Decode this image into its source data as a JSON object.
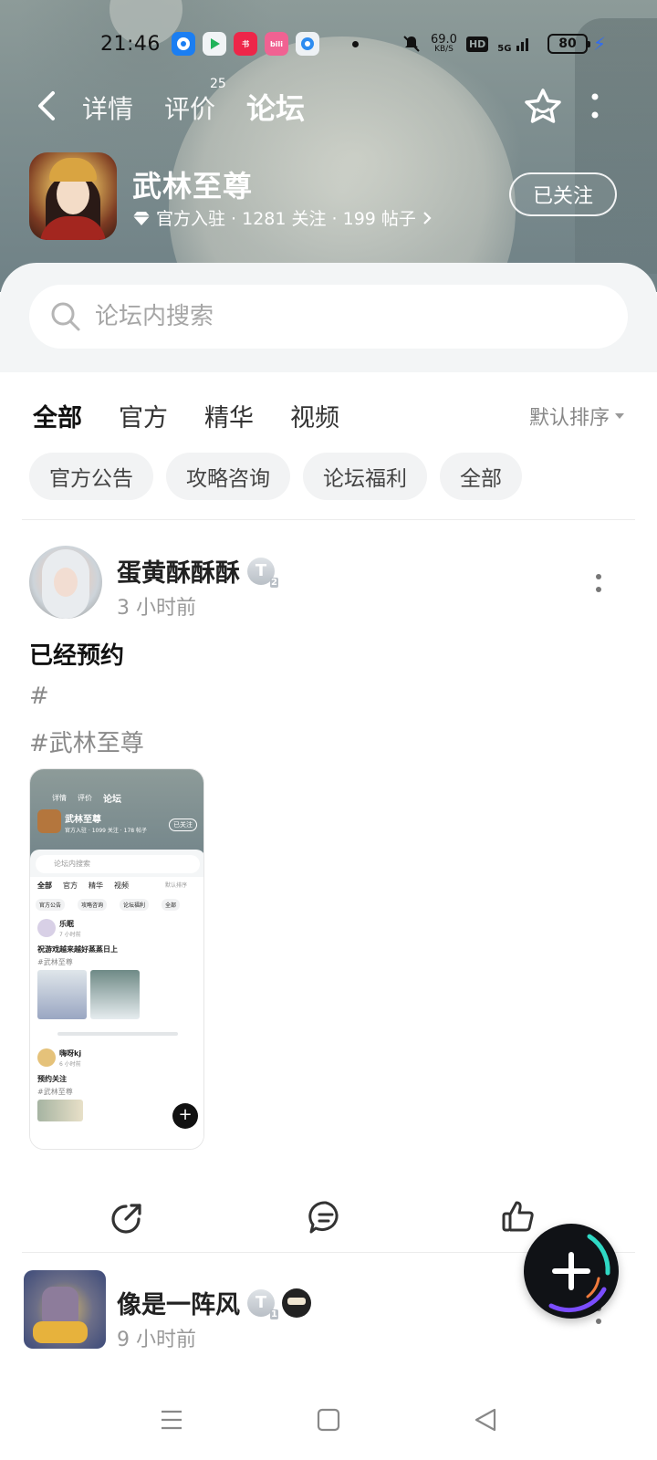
{
  "status_bar": {
    "time": "21:46",
    "net_speed_value": "69.0",
    "net_speed_unit": "KB/S",
    "hd_label": "HD",
    "signal_label": "5G",
    "battery": "80",
    "app_icons": [
      "weibo-icon",
      "video-icon",
      "xiaohongshu-icon",
      "bilibili-icon",
      "browser-icon"
    ]
  },
  "nav": {
    "tabs": [
      {
        "label": "详情"
      },
      {
        "label": "评价",
        "badge": "25"
      },
      {
        "label": "论坛"
      }
    ],
    "active_tab": "论坛"
  },
  "game": {
    "title": "武林至尊",
    "meta": "官方入驻 · 1281 关注 · 199 帖子",
    "follow_label": "已关注"
  },
  "search": {
    "placeholder": "论坛内搜索"
  },
  "filters": {
    "tabs": [
      "全部",
      "官方",
      "精华",
      "视频"
    ],
    "active": "全部",
    "sort_label": "默认排序"
  },
  "chips": [
    "官方公告",
    "攻略咨询",
    "论坛福利",
    "全部"
  ],
  "posts": [
    {
      "username": "蛋黄酥酥酥",
      "level_badge": "T",
      "level_number": "2",
      "time": "3 小时前",
      "text": "已经预约",
      "tags": [
        "#",
        "#武林至尊"
      ]
    },
    {
      "username": "像是一阵风",
      "level_badge": "T",
      "level_number": "1",
      "time": "9 小时前"
    }
  ],
  "thumbnail": {
    "tabs": [
      "详情",
      "评价",
      "论坛"
    ],
    "title": "武林至尊",
    "meta": "官方入驻 · 1099 关注 · 178 帖子",
    "follow": "已关注",
    "search": "论坛内搜索",
    "filters": [
      "全部",
      "官方",
      "精华",
      "视频"
    ],
    "sort": "默认排序",
    "chips": [
      "官方公告",
      "攻略咨询",
      "论坛福利",
      "全部"
    ],
    "post1_user": "乐眠",
    "post1_time": "7 小时前",
    "post1_text": "祝游戏越来越好蒸蒸日上",
    "post1_tag": "#武林至尊",
    "post2_user": "嗨呀kj",
    "post2_time": "6 小时前",
    "post2_text": "预约关注",
    "post2_tag": "#武林至尊"
  },
  "colors": {
    "accent": "#28d4c2",
    "header_bg": "#7f8f90",
    "sheet_bg": "#f3f5f6",
    "fab_bg": "#101216"
  }
}
